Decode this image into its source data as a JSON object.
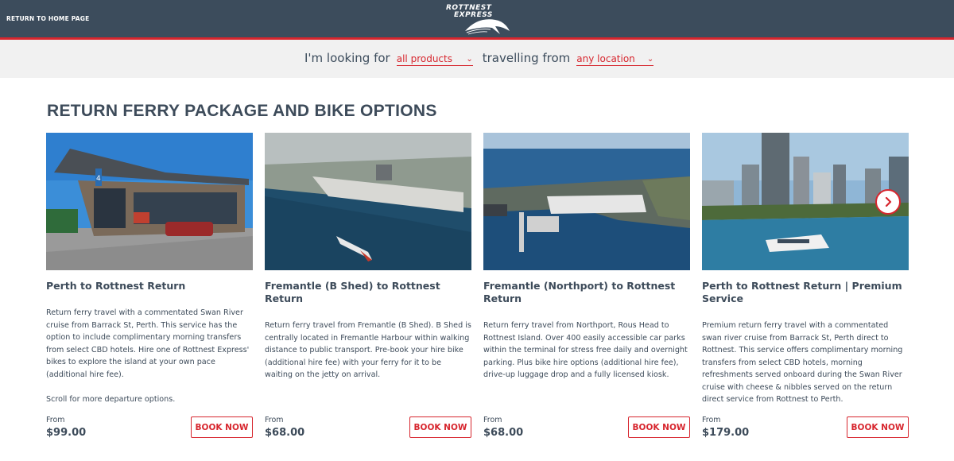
{
  "header": {
    "return_label": "RETURN TO HOME PAGE",
    "logo_line1": "ROTTNEST",
    "logo_line2": "EXPRESS"
  },
  "filter": {
    "looking_for": "I'm looking for",
    "product_value": "all products",
    "travelling_from": "travelling from",
    "location_value": "any location"
  },
  "section": {
    "title": "RETURN FERRY PACKAGE AND BIKE OPTIONS"
  },
  "cards": [
    {
      "title": "Perth to Rottnest Return",
      "description": "Return ferry travel with a commentated Swan River cruise from Barrack St, Perth. This service has the option to include complimentary morning transfers from select CBD hotels. Hire one of Rottnest Express' bikes to explore the island at your own pace (additional hire fee).",
      "note": "Scroll for more departure options.",
      "from_label": "From",
      "price": "$99.00",
      "book_label": "BOOK NOW"
    },
    {
      "title": "Fremantle (B Shed) to Rottnest Return",
      "description": "Return ferry travel from Fremantle (B Shed). B Shed is centrally located in Fremantle Harbour within walking distance to public transport. Pre-book your hire bike (additional hire fee) with your ferry for it to be waiting on the jetty on arrival.",
      "from_label": "From",
      "price": "$68.00",
      "book_label": "BOOK NOW"
    },
    {
      "title": "Fremantle (Northport) to Rottnest Return",
      "description": "Return ferry travel from Northport, Rous Head to Rottnest Island. Over 400 easily accessible car parks within the terminal for stress free daily and overnight parking. Plus bike hire options (additional hire fee), drive-up luggage drop and a fully licensed kiosk.",
      "from_label": "From",
      "price": "$68.00",
      "book_label": "BOOK NOW"
    },
    {
      "title": "Perth to Rottnest Return | Premium Service",
      "description": "Premium return ferry travel with a commentated swan river cruise from Barrack St, Perth direct to Rottnest. This service offers complimentary morning transfers from select CBD hotels, morning refreshments served onboard during the Swan River cruise with cheese & nibbles served on the return direct service from Rottnest to Perth.",
      "from_label": "From",
      "price": "$179.00",
      "book_label": "BOOK NOW"
    }
  ],
  "photos": {
    "card1_sign": "4"
  },
  "colors": {
    "header_bg": "#3c4c5c",
    "accent_red": "#d7262e",
    "text_dark": "#3d4b5a",
    "filter_bg": "#f1f1f1"
  },
  "icons": {
    "dropdown": "chevron-down-icon",
    "carousel_next": "chevron-right-icon",
    "logo": "dolphin-logo"
  }
}
